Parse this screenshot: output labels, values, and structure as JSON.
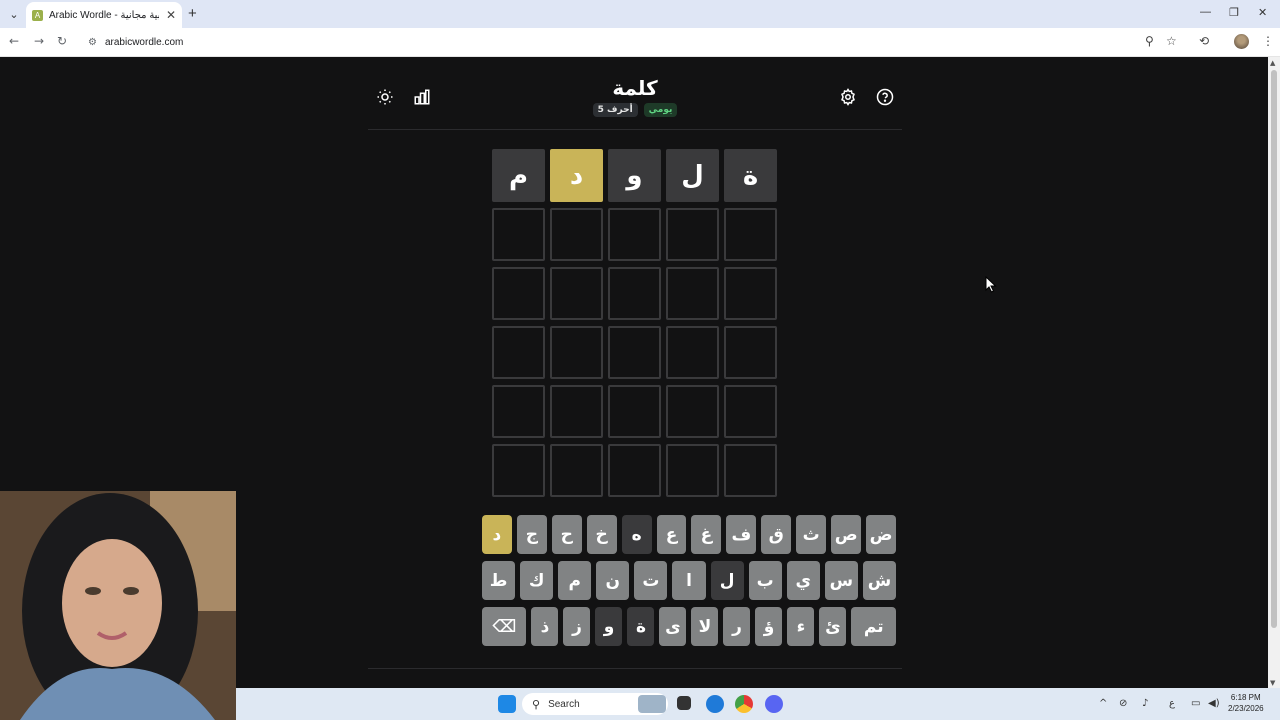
{
  "browser": {
    "tab_title": "Arabic Wordle - ألغاز عربية مجانية",
    "favicon_letter": "A",
    "url": "arabicwordle.com",
    "accent": "#dfe6f5"
  },
  "game": {
    "title": "كلمة",
    "badge_letters": "5 أحرف",
    "badge_daily": "يومي",
    "colors": {
      "background": "#121213",
      "absent": "#3a3a3c",
      "present": "#c9b458",
      "key": "#818384",
      "empty_border": "#3a3a3c"
    },
    "board": [
      [
        {
          "letter": "م",
          "state": "absent"
        },
        {
          "letter": "د",
          "state": "present"
        },
        {
          "letter": "و",
          "state": "absent"
        },
        {
          "letter": "ل",
          "state": "absent"
        },
        {
          "letter": "ة",
          "state": "absent"
        }
      ],
      [
        {
          "letter": "",
          "state": "empty"
        },
        {
          "letter": "",
          "state": "empty"
        },
        {
          "letter": "",
          "state": "empty"
        },
        {
          "letter": "",
          "state": "empty"
        },
        {
          "letter": "",
          "state": "empty"
        }
      ],
      [
        {
          "letter": "",
          "state": "empty"
        },
        {
          "letter": "",
          "state": "empty"
        },
        {
          "letter": "",
          "state": "empty"
        },
        {
          "letter": "",
          "state": "empty"
        },
        {
          "letter": "",
          "state": "empty"
        }
      ],
      [
        {
          "letter": "",
          "state": "empty"
        },
        {
          "letter": "",
          "state": "empty"
        },
        {
          "letter": "",
          "state": "empty"
        },
        {
          "letter": "",
          "state": "empty"
        },
        {
          "letter": "",
          "state": "empty"
        }
      ],
      [
        {
          "letter": "",
          "state": "empty"
        },
        {
          "letter": "",
          "state": "empty"
        },
        {
          "letter": "",
          "state": "empty"
        },
        {
          "letter": "",
          "state": "empty"
        },
        {
          "letter": "",
          "state": "empty"
        }
      ],
      [
        {
          "letter": "",
          "state": "empty"
        },
        {
          "letter": "",
          "state": "empty"
        },
        {
          "letter": "",
          "state": "empty"
        },
        {
          "letter": "",
          "state": "empty"
        },
        {
          "letter": "",
          "state": "empty"
        }
      ]
    ],
    "keyboard": {
      "row1": [
        {
          "key": "ض",
          "state": "unused"
        },
        {
          "key": "ص",
          "state": "unused"
        },
        {
          "key": "ث",
          "state": "unused"
        },
        {
          "key": "ق",
          "state": "unused"
        },
        {
          "key": "ف",
          "state": "unused"
        },
        {
          "key": "غ",
          "state": "unused"
        },
        {
          "key": "ع",
          "state": "unused"
        },
        {
          "key": "ه",
          "state": "absent"
        },
        {
          "key": "خ",
          "state": "unused"
        },
        {
          "key": "ح",
          "state": "unused"
        },
        {
          "key": "ج",
          "state": "unused"
        },
        {
          "key": "د",
          "state": "present"
        }
      ],
      "row2": [
        {
          "key": "ش",
          "state": "unused"
        },
        {
          "key": "س",
          "state": "unused"
        },
        {
          "key": "ي",
          "state": "unused"
        },
        {
          "key": "ب",
          "state": "unused"
        },
        {
          "key": "ل",
          "state": "absent"
        },
        {
          "key": "ا",
          "state": "unused"
        },
        {
          "key": "ت",
          "state": "unused"
        },
        {
          "key": "ن",
          "state": "unused"
        },
        {
          "key": "م",
          "state": "unused"
        },
        {
          "key": "ك",
          "state": "unused"
        },
        {
          "key": "ط",
          "state": "unused"
        }
      ],
      "row3": [
        {
          "key": "تم",
          "state": "unused",
          "wide": true,
          "name": "enter-key"
        },
        {
          "key": "ئ",
          "state": "unused"
        },
        {
          "key": "ء",
          "state": "unused"
        },
        {
          "key": "ؤ",
          "state": "unused"
        },
        {
          "key": "ر",
          "state": "unused"
        },
        {
          "key": "لا",
          "state": "unused"
        },
        {
          "key": "ى",
          "state": "unused"
        },
        {
          "key": "ة",
          "state": "absent"
        },
        {
          "key": "و",
          "state": "absent"
        },
        {
          "key": "ز",
          "state": "unused"
        },
        {
          "key": "ذ",
          "state": "unused"
        },
        {
          "key": "⌫",
          "state": "unused",
          "wide": true,
          "name": "backspace-key"
        }
      ]
    }
  },
  "taskbar": {
    "search_placeholder": "Search",
    "time": "6:18 PM",
    "date": "2/23/2026",
    "lang": "ع"
  },
  "icons": {
    "theme": "sun-icon",
    "stats": "bar-chart-icon",
    "settings": "gear-icon",
    "help": "help-icon"
  }
}
